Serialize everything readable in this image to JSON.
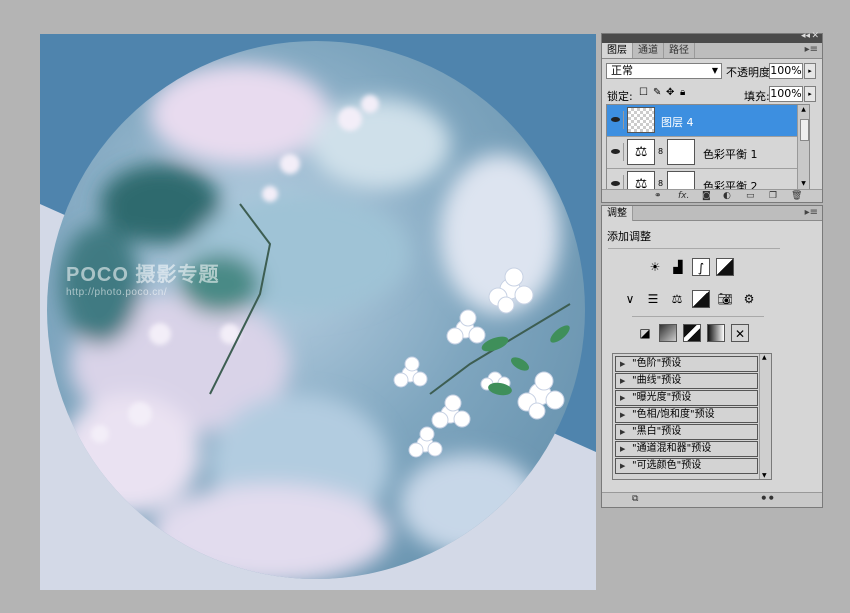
{
  "watermark": {
    "brand": "POCO 摄影专题",
    "url": "http://photo.poco.cn/"
  },
  "layers_panel": {
    "tabs": [
      "图层",
      "通道",
      "路径"
    ],
    "blend_mode": "正常",
    "opacity_label": "不透明度:",
    "opacity_value": "100%",
    "lock_label": "锁定:",
    "fill_label": "填充:",
    "fill_value": "100%",
    "layers": [
      {
        "name": "图层 4",
        "selected": true
      },
      {
        "name": "色彩平衡 1",
        "selected": false
      },
      {
        "name": "色彩平衡 2",
        "selected": false
      }
    ]
  },
  "adjustments_panel": {
    "tab": "调整",
    "heading": "添加调整",
    "presets": [
      "\"色阶\"预设",
      "\"曲线\"预设",
      "\"曝光度\"预设",
      "\"色相/饱和度\"预设",
      "\"黑白\"预设",
      "\"通道混和器\"预设",
      "\"可选颜色\"预设"
    ]
  },
  "colors": {
    "canvas_bg": "#4f84ad",
    "selected_layer": "#3d8fe0"
  }
}
